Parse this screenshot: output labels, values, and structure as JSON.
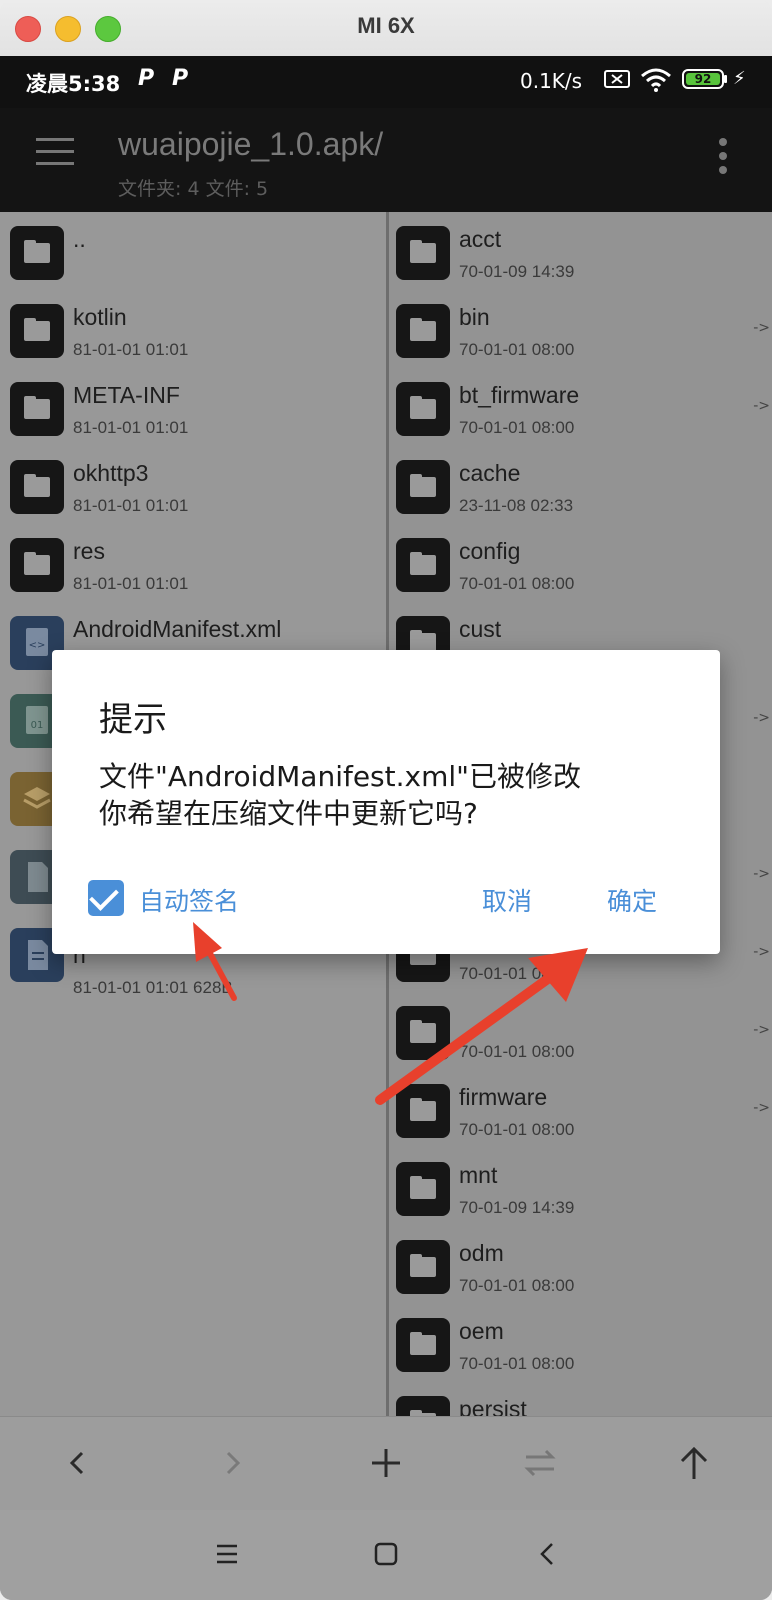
{
  "window": {
    "title": "MI 6X"
  },
  "statusbar": {
    "time": "凌晨5:38",
    "p1": "P",
    "p2": "P",
    "speed": "0.1K/s",
    "battery": "92"
  },
  "appbar": {
    "title": "wuaipojie_1.0.apk/",
    "subtitle": "文件夹: 4  文件: 5"
  },
  "left_pane": {
    "items": [
      {
        "name": "..",
        "date": ""
      },
      {
        "name": "kotlin",
        "date": "81-01-01 01:01"
      },
      {
        "name": "META-INF",
        "date": "81-01-01 01:01"
      },
      {
        "name": "okhttp3",
        "date": "81-01-01 01:01"
      },
      {
        "name": "res",
        "date": "81-01-01 01:01"
      },
      {
        "name": "AndroidManifest.xml",
        "date": ""
      },
      {
        "name": "n",
        "date": "81-01-01 01:01  628B"
      }
    ]
  },
  "right_pane": {
    "items": [
      {
        "name": "acct",
        "date": "70-01-09 14:39"
      },
      {
        "name": "bin",
        "date": "70-01-01 08:00",
        "link": "->"
      },
      {
        "name": "bt_firmware",
        "date": "70-01-01 08:00",
        "link": "->"
      },
      {
        "name": "cache",
        "date": "23-11-08 02:33"
      },
      {
        "name": "config",
        "date": "70-01-01 08:00"
      },
      {
        "name": "cust",
        "date": ""
      },
      {
        "name": "",
        "date": "70-01-01 08:00",
        "link": "->"
      },
      {
        "name": "",
        "date": "70-01-01 08:00",
        "link": "->"
      },
      {
        "name": "firmware",
        "date": "70-01-01 08:00",
        "link": "->"
      },
      {
        "name": "mnt",
        "date": "70-01-09 14:39"
      },
      {
        "name": "odm",
        "date": "70-01-01 08:00"
      },
      {
        "name": "oem",
        "date": "70-01-01 08:00"
      },
      {
        "name": "persist",
        "date": ""
      }
    ]
  },
  "dialog": {
    "title": "提示",
    "message_line1": "文件\"AndroidManifest.xml\"已被修改",
    "message_line2": "你希望在压缩文件中更新它吗?",
    "checkbox_label": "自动签名",
    "checkbox_checked": true,
    "cancel_label": "取消",
    "ok_label": "确定"
  },
  "colors": {
    "accent": "#4a8fd8",
    "annotation_arrow": "#e8402c"
  }
}
